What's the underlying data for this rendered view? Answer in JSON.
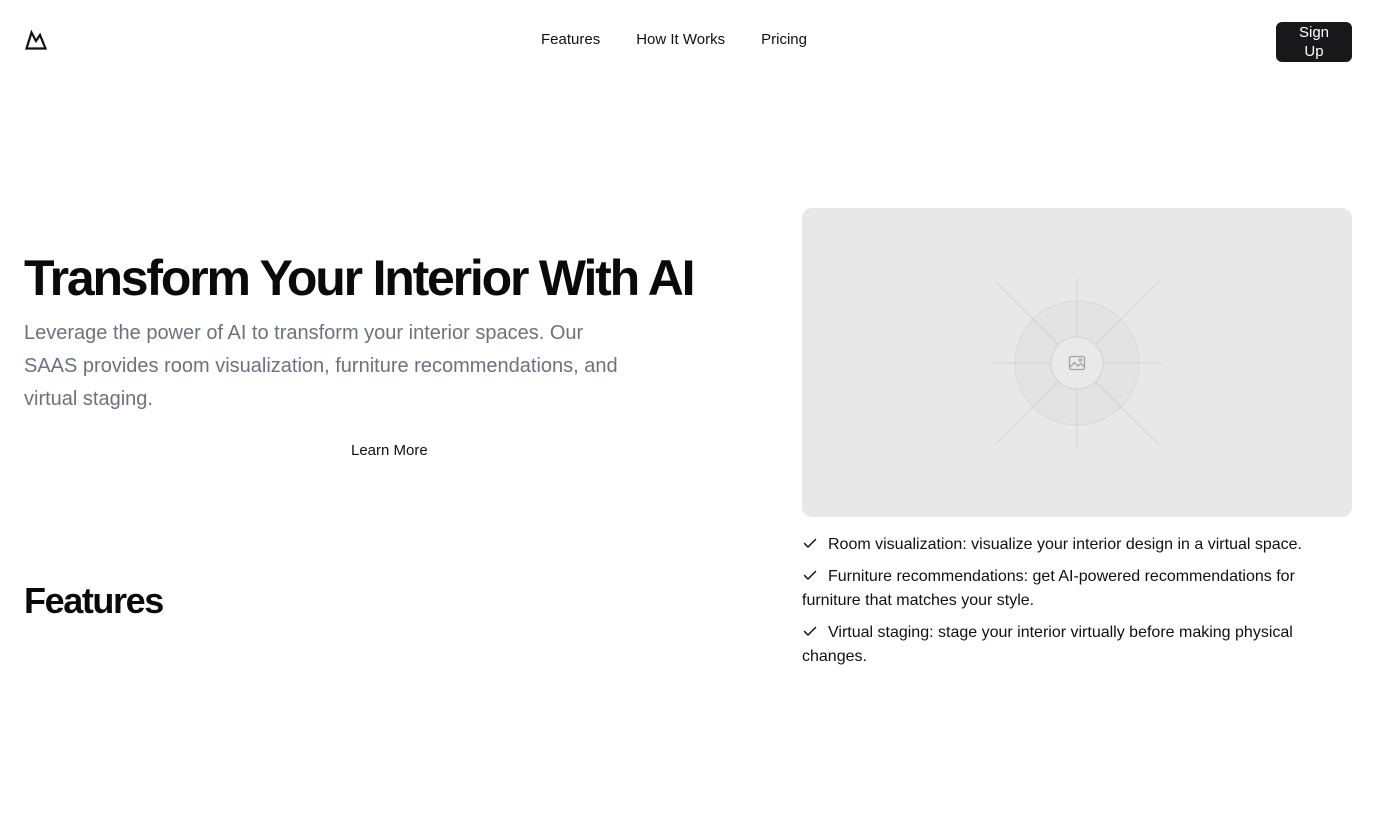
{
  "header": {
    "logo_icon": "mountain-logo-icon",
    "nav_items": [
      "Features",
      "How It Works",
      "Pricing"
    ],
    "signup_label": "Sign Up"
  },
  "hero": {
    "title": "Transform Your Interior With AI",
    "subtitle": "Leverage the power of AI to transform your interior spaces. Our SAAS provides room visualization, furniture recommendations, and virtual staging.",
    "learn_more_label": "Learn More",
    "image_placeholder_icon": "image-icon"
  },
  "features": {
    "title": "Features",
    "items": [
      "Room visualization: visualize your interior design in a virtual space.",
      "Furniture recommendations: get AI-powered recommendations for furniture that matches your style.",
      "Virtual staging: stage your interior virtually before making physical changes."
    ],
    "item_icon": "check-icon"
  },
  "colors": {
    "primary_button_bg": "#18181b",
    "subtitle_text": "#6b7280",
    "placeholder_bg": "#e8e8e8"
  }
}
